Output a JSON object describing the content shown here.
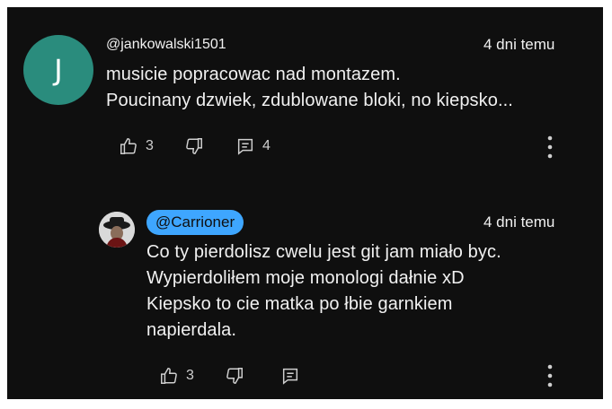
{
  "comment": {
    "avatar_letter": "J",
    "avatar_color": "#2a8c7d",
    "handle": "@jankowalski1501",
    "time": "4 dni temu",
    "lines": [
      "musicie popracowac nad montazem.",
      "Poucinany dzwiek, zdublowane bloki, no kiepsko..."
    ],
    "likes": "3",
    "replies": "4"
  },
  "reply": {
    "handle": "@Carrioner",
    "time": "4 dni temu",
    "lines": [
      "Co ty pierdolisz cwelu jest git jam miało byc.",
      "Wypierdoliłem moje monologi dałnie xD",
      "Kiepsko to cie matka po łbie garnkiem",
      "napierdala."
    ],
    "likes": "3"
  },
  "icons": [
    "thumb-up-icon",
    "thumb-down-icon",
    "comment-icon",
    "more-vert-icon"
  ],
  "colors": {
    "background": "#0f0f0f",
    "text": "#f1f1f1",
    "accent": "#3ea6ff"
  }
}
